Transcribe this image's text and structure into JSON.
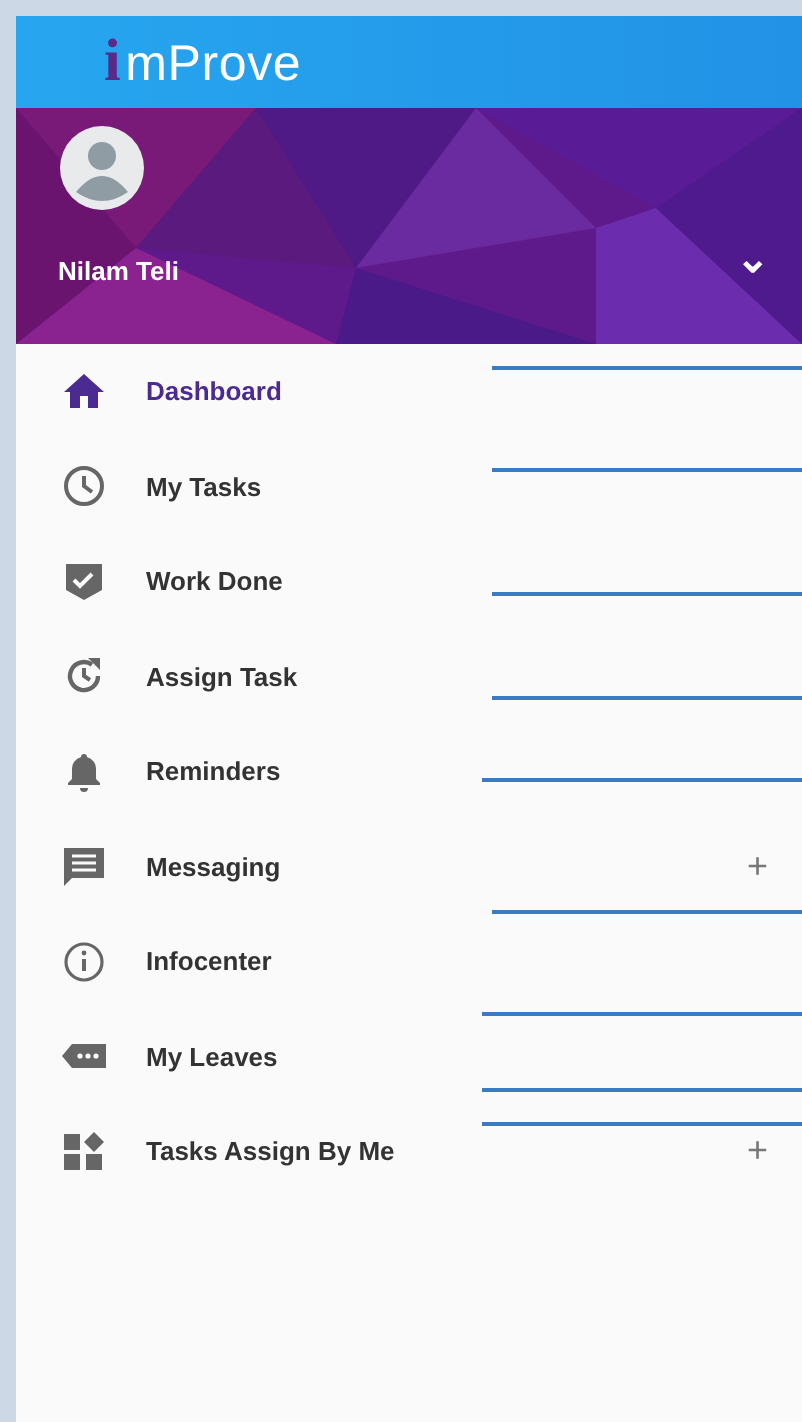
{
  "app_bar": {
    "logo_initial": "i",
    "logo_text": "mProve"
  },
  "profile": {
    "name": "Nilam Teli",
    "chevron": "⌄"
  },
  "menu": [
    {
      "label": "Dashboard",
      "selected": true
    },
    {
      "label": "My Tasks",
      "selected": false
    },
    {
      "label": "Work Done",
      "selected": false
    },
    {
      "label": "Assign Task",
      "selected": false
    },
    {
      "label": "Reminders",
      "selected": false
    },
    {
      "label": "Messaging",
      "selected": false,
      "toggle": "+"
    },
    {
      "label": "Infocenter",
      "selected": false
    },
    {
      "label": "My Leaves",
      "selected": false
    },
    {
      "label": "Tasks Assign By Me",
      "selected": false,
      "toggle": "+"
    }
  ]
}
